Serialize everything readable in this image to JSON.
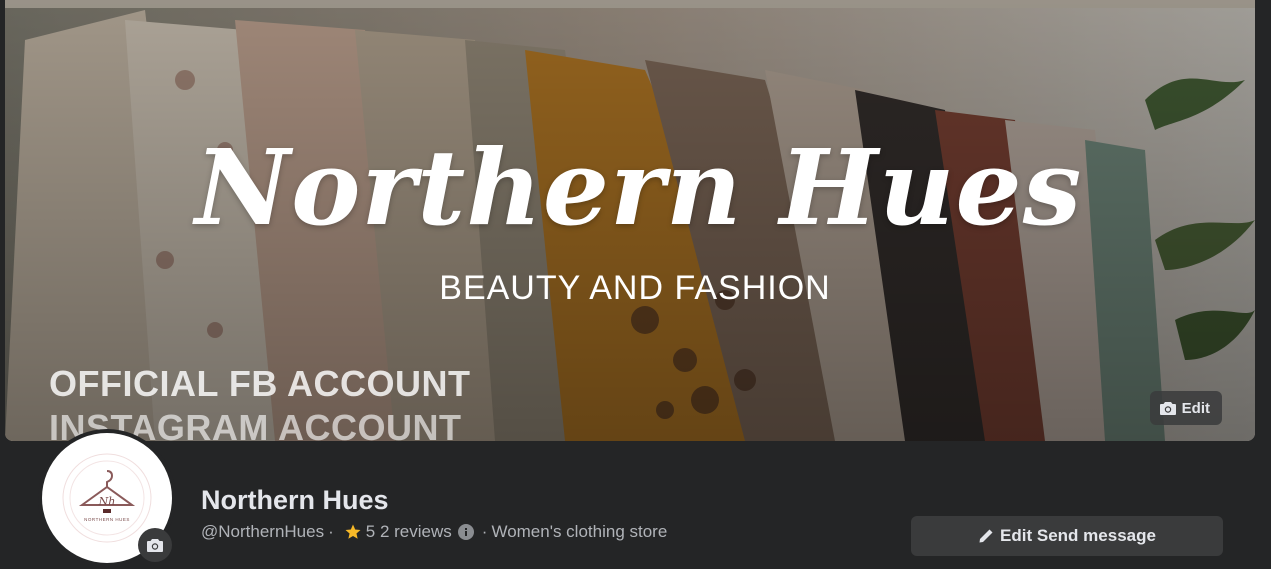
{
  "cover": {
    "title": "Northern Hues",
    "subtitle": "BEAUTY AND FASHION",
    "line1": "OFFICIAL FB ACCOUNT",
    "line2": "INSTAGRAM ACCOUNT",
    "edit_label": "Edit",
    "edit_icon": "camera-icon"
  },
  "profile": {
    "name": "Northern Hues",
    "handle": "@NorthernHues",
    "separator": "·",
    "rating": "5",
    "reviews": "2 reviews",
    "category": "Women's clothing store",
    "avatar_logo_text": "NORTHERN HUES",
    "avatar_initials": "Nh"
  },
  "actions": {
    "send_message_label": "Edit Send message",
    "send_message_icon": "pencil-icon"
  },
  "colors": {
    "background": "#242526",
    "button": "#3a3b3c",
    "text_primary": "#e4e6eb",
    "text_secondary": "#b0b3b8",
    "star": "#f7b928"
  }
}
